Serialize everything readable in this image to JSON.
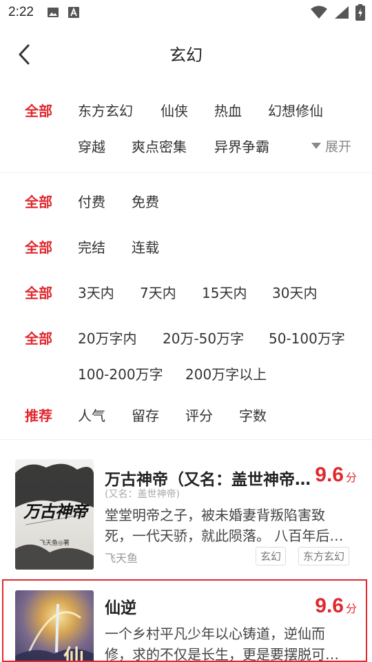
{
  "status": {
    "time": "2:22"
  },
  "header": {
    "title": "玄幻"
  },
  "filters": {
    "expand_label": "展开",
    "row1": {
      "all": "全部",
      "items": [
        "东方玄幻",
        "仙侠",
        "热血",
        "幻想修仙",
        "穿越",
        "爽点密集",
        "异界争霸"
      ]
    },
    "row2": {
      "all": "全部",
      "items": [
        "付费",
        "免费"
      ]
    },
    "row3": {
      "all": "全部",
      "items": [
        "完结",
        "连载"
      ]
    },
    "row4": {
      "all": "全部",
      "items": [
        "3天内",
        "7天内",
        "15天内",
        "30天内"
      ]
    },
    "row5": {
      "all": "全部",
      "items": [
        "20万字内",
        "20万-50万字",
        "50-100万字",
        "100-200万字",
        "200万字以上"
      ]
    },
    "row6": {
      "all": "推荐",
      "items": [
        "人气",
        "留存",
        "评分",
        "字数"
      ]
    }
  },
  "books": [
    {
      "title": "万古神帝（又名：盖世神帝…",
      "alias": "(又名：盖世神帝)",
      "score": "9.6",
      "score_unit": "分",
      "desc_line1": "堂堂明帝之子，被未婚妻背叛陷害致",
      "desc_line2": "死，一代天骄，就此陨落。 八百年后…",
      "author": "飞天鱼",
      "tags": [
        "玄幻",
        "东方玄幻"
      ],
      "cover_text": "万古神帝",
      "cover_author": "飞天鱼◎著"
    },
    {
      "title": "仙逆",
      "score": "9.6",
      "score_unit": "分",
      "desc_line1": "一个乡村平凡少年以心铸道，逆仙而",
      "desc_line2": "修，求的不仅是长生，更是要摆脱可…",
      "cover_text": "仙"
    }
  ],
  "colors": {
    "accent": "#e0282e"
  }
}
